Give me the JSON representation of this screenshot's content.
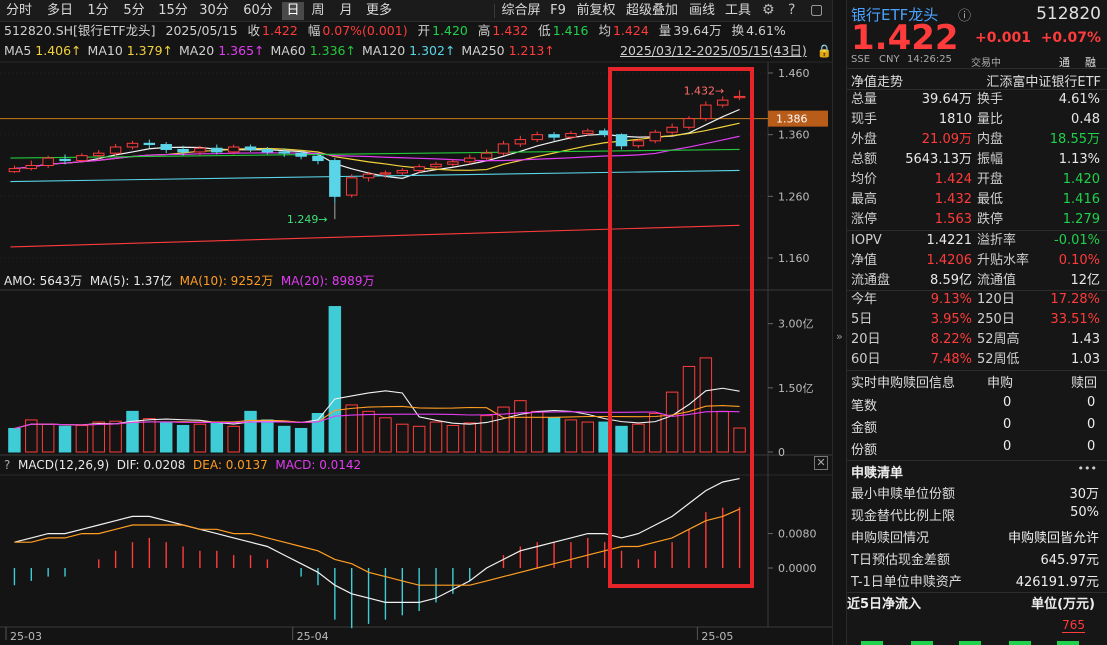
{
  "toolbar": {
    "tabs": [
      "分时",
      "多日",
      "1分",
      "5分",
      "15分",
      "30分",
      "60分",
      "日",
      "周",
      "月",
      "更多"
    ],
    "active_tab": "日",
    "right": [
      "综合屏",
      "F9",
      "前复权",
      "超级叠加",
      "画线",
      "工具"
    ]
  },
  "quote_line": {
    "code_name": "512820.SH[银行ETF龙头]",
    "date": "2025/05/15",
    "close_label": "收",
    "close": "1.422",
    "change_label": "幅",
    "change": "0.07%(0.001)",
    "open_label": "开",
    "open": "1.420",
    "high_label": "高",
    "high": "1.432",
    "low_label": "低",
    "low": "1.416",
    "avg_label": "均",
    "avg": "1.424",
    "vol_label": "量",
    "vol": "39.64万",
    "turn_label": "换",
    "turn": "4.61%"
  },
  "ma_line": {
    "items": [
      {
        "label": "MA5",
        "value": "1.406↑",
        "color": "#f2d13a"
      },
      {
        "label": "MA10",
        "value": "1.379↑",
        "color": "#f2d13a"
      },
      {
        "label": "MA20",
        "value": "1.365↑",
        "color": "#e23cf2"
      },
      {
        "label": "MA60",
        "value": "1.336↑",
        "color": "#24c93a"
      },
      {
        "label": "MA120",
        "value": "1.302↑",
        "color": "#5ad5e8"
      },
      {
        "label": "MA250",
        "value": "1.213↑",
        "color": "#ff3b3b"
      }
    ],
    "range": "2025/03/12-2025/05/15(43日)"
  },
  "price_axis": {
    "ticks": [
      "1.460",
      "1.360",
      "1.260",
      "1.160"
    ],
    "current": "1.386",
    "high_marker": "1.432",
    "low_marker": "1.249"
  },
  "amo_line": {
    "amo": "AMO: 5643万",
    "ma5": "MA(5): 1.37亿",
    "ma10": "MA(10): 9252万",
    "ma20": "MA(20): 8989万"
  },
  "amo_axis": {
    "ticks": [
      "3.00亿",
      "1.50亿",
      "0"
    ]
  },
  "macd_line": {
    "title": "MACD(12,26,9)",
    "dif": "DIF: 0.0208",
    "dea": "DEA: 0.0137",
    "macd": "MACD: 0.0142"
  },
  "macd_axis": {
    "ticks": [
      "0.0080",
      "0.0000"
    ]
  },
  "date_axis": {
    "labels": [
      "25-03",
      "25-04",
      "25-05"
    ]
  },
  "chart_data": {
    "type": "candlestick",
    "series": [
      {
        "open": 1.3,
        "close": 1.305,
        "high": 1.31,
        "low": 1.298
      },
      {
        "open": 1.305,
        "close": 1.31,
        "high": 1.318,
        "low": 1.302
      },
      {
        "open": 1.31,
        "close": 1.322,
        "high": 1.326,
        "low": 1.306
      },
      {
        "open": 1.32,
        "close": 1.318,
        "high": 1.328,
        "low": 1.312
      },
      {
        "open": 1.318,
        "close": 1.326,
        "high": 1.33,
        "low": 1.316
      },
      {
        "open": 1.326,
        "close": 1.33,
        "high": 1.335,
        "low": 1.32
      },
      {
        "open": 1.33,
        "close": 1.34,
        "high": 1.345,
        "low": 1.326
      },
      {
        "open": 1.34,
        "close": 1.346,
        "high": 1.35,
        "low": 1.336
      },
      {
        "open": 1.346,
        "close": 1.344,
        "high": 1.352,
        "low": 1.338
      },
      {
        "open": 1.344,
        "close": 1.336,
        "high": 1.348,
        "low": 1.33
      },
      {
        "open": 1.336,
        "close": 1.332,
        "high": 1.342,
        "low": 1.326
      },
      {
        "open": 1.332,
        "close": 1.338,
        "high": 1.342,
        "low": 1.326
      },
      {
        "open": 1.338,
        "close": 1.332,
        "high": 1.344,
        "low": 1.328
      },
      {
        "open": 1.332,
        "close": 1.34,
        "high": 1.344,
        "low": 1.328
      },
      {
        "open": 1.34,
        "close": 1.336,
        "high": 1.344,
        "low": 1.332
      },
      {
        "open": 1.336,
        "close": 1.332,
        "high": 1.34,
        "low": 1.328
      },
      {
        "open": 1.332,
        "close": 1.33,
        "high": 1.338,
        "low": 1.324
      },
      {
        "open": 1.33,
        "close": 1.325,
        "high": 1.334,
        "low": 1.32
      },
      {
        "open": 1.325,
        "close": 1.318,
        "high": 1.33,
        "low": 1.312
      },
      {
        "open": 1.318,
        "close": 1.26,
        "high": 1.322,
        "low": 1.249
      },
      {
        "open": 1.262,
        "close": 1.29,
        "high": 1.296,
        "low": 1.258
      },
      {
        "open": 1.29,
        "close": 1.296,
        "high": 1.3,
        "low": 1.284
      },
      {
        "open": 1.296,
        "close": 1.298,
        "high": 1.302,
        "low": 1.29
      },
      {
        "open": 1.298,
        "close": 1.302,
        "high": 1.306,
        "low": 1.294
      },
      {
        "open": 1.302,
        "close": 1.308,
        "high": 1.312,
        "low": 1.298
      },
      {
        "open": 1.308,
        "close": 1.312,
        "high": 1.316,
        "low": 1.304
      },
      {
        "open": 1.312,
        "close": 1.316,
        "high": 1.32,
        "low": 1.308
      },
      {
        "open": 1.316,
        "close": 1.322,
        "high": 1.328,
        "low": 1.312
      },
      {
        "open": 1.322,
        "close": 1.33,
        "high": 1.336,
        "low": 1.318
      },
      {
        "open": 1.33,
        "close": 1.345,
        "high": 1.35,
        "low": 1.326
      },
      {
        "open": 1.345,
        "close": 1.352,
        "high": 1.358,
        "low": 1.34
      },
      {
        "open": 1.352,
        "close": 1.36,
        "high": 1.365,
        "low": 1.348
      },
      {
        "open": 1.36,
        "close": 1.356,
        "high": 1.364,
        "low": 1.35
      },
      {
        "open": 1.356,
        "close": 1.362,
        "high": 1.366,
        "low": 1.352
      },
      {
        "open": 1.362,
        "close": 1.366,
        "high": 1.37,
        "low": 1.358
      },
      {
        "open": 1.366,
        "close": 1.36,
        "high": 1.37,
        "low": 1.356
      },
      {
        "open": 1.36,
        "close": 1.342,
        "high": 1.362,
        "low": 1.336
      },
      {
        "open": 1.342,
        "close": 1.35,
        "high": 1.354,
        "low": 1.338
      },
      {
        "open": 1.35,
        "close": 1.364,
        "high": 1.368,
        "low": 1.346
      },
      {
        "open": 1.364,
        "close": 1.372,
        "high": 1.378,
        "low": 1.36
      },
      {
        "open": 1.372,
        "close": 1.386,
        "high": 1.39,
        "low": 1.368
      },
      {
        "open": 1.386,
        "close": 1.408,
        "high": 1.414,
        "low": 1.382
      },
      {
        "open": 1.408,
        "close": 1.416,
        "high": 1.422,
        "low": 1.404
      },
      {
        "open": 1.42,
        "close": 1.422,
        "high": 1.432,
        "low": 1.416
      }
    ],
    "amo": [
      0.55,
      0.75,
      0.65,
      0.6,
      0.62,
      0.7,
      0.72,
      0.95,
      0.78,
      0.7,
      0.62,
      0.65,
      0.7,
      0.6,
      0.95,
      0.75,
      0.6,
      0.55,
      0.9,
      3.4,
      1.1,
      0.95,
      0.8,
      0.65,
      0.6,
      0.7,
      0.62,
      0.68,
      0.85,
      1.05,
      1.2,
      0.95,
      0.8,
      0.75,
      0.7,
      0.7,
      0.6,
      0.65,
      0.9,
      1.4,
      2.0,
      2.2,
      0.95,
      0.56
    ],
    "amo_dir": [
      -1,
      1,
      1,
      -1,
      1,
      1,
      1,
      -1,
      1,
      -1,
      -1,
      1,
      -1,
      1,
      -1,
      -1,
      -1,
      -1,
      -1,
      -1,
      1,
      1,
      1,
      1,
      1,
      1,
      1,
      1,
      1,
      1,
      1,
      1,
      -1,
      1,
      1,
      -1,
      -1,
      1,
      1,
      1,
      1,
      1,
      1,
      1
    ],
    "macd": [
      -0.004,
      -0.003,
      -0.002,
      -0.002,
      0.0,
      0.002,
      0.004,
      0.006,
      0.007,
      0.006,
      0.005,
      0.004,
      0.004,
      0.003,
      0.003,
      0.002,
      0.0,
      -0.002,
      -0.004,
      -0.012,
      -0.014,
      -0.013,
      -0.012,
      -0.011,
      -0.01,
      -0.008,
      -0.006,
      -0.003,
      0.0,
      0.003,
      0.005,
      0.006,
      0.006,
      0.006,
      0.007,
      0.006,
      0.004,
      0.002,
      0.004,
      0.006,
      0.009,
      0.013,
      0.014,
      0.0142
    ],
    "dif": [
      0.006,
      0.007,
      0.008,
      0.008,
      0.009,
      0.01,
      0.011,
      0.012,
      0.012,
      0.011,
      0.01,
      0.009,
      0.008,
      0.007,
      0.006,
      0.005,
      0.003,
      0.001,
      -0.001,
      -0.004,
      -0.006,
      -0.007,
      -0.008,
      -0.008,
      -0.008,
      -0.007,
      -0.005,
      -0.003,
      0.0,
      0.002,
      0.004,
      0.005,
      0.006,
      0.007,
      0.008,
      0.008,
      0.007,
      0.008,
      0.01,
      0.012,
      0.015,
      0.018,
      0.02,
      0.0208
    ],
    "dea": [
      0.006,
      0.006,
      0.007,
      0.007,
      0.008,
      0.008,
      0.009,
      0.01,
      0.01,
      0.01,
      0.01,
      0.009,
      0.009,
      0.008,
      0.008,
      0.007,
      0.006,
      0.005,
      0.004,
      0.002,
      0.001,
      -0.001,
      -0.002,
      -0.003,
      -0.004,
      -0.004,
      -0.004,
      -0.004,
      -0.003,
      -0.002,
      -0.001,
      0.0,
      0.001,
      0.002,
      0.003,
      0.004,
      0.005,
      0.005,
      0.006,
      0.007,
      0.009,
      0.011,
      0.012,
      0.0137
    ]
  },
  "right_panel": {
    "title": "银行ETF龙头",
    "code": "512820",
    "price": "1.422",
    "change": "+0.001",
    "change_pct": "+0.07%",
    "sub": [
      "SSE",
      "CNY",
      "14:26:25",
      "交易中"
    ],
    "sub_right": [
      "通",
      "融"
    ],
    "nav_label": "净值走势",
    "fund_name": "汇添富中证银行ETF",
    "rows1": [
      {
        "l1": "总量",
        "v1": "39.64万",
        "c1": "white",
        "l2": "换手",
        "v2": "4.61%",
        "c2": "white"
      },
      {
        "l1": "现手",
        "v1": "1810",
        "c1": "white",
        "l2": "量比",
        "v2": "0.48",
        "c2": "white"
      },
      {
        "l1": "外盘",
        "v1": "21.09万",
        "c1": "red",
        "l2": "内盘",
        "v2": "18.55万",
        "c2": "green"
      },
      {
        "l1": "总额",
        "v1": "5643.13万",
        "c1": "white",
        "l2": "振幅",
        "v2": "1.13%",
        "c2": "white"
      },
      {
        "l1": "均价",
        "v1": "1.424",
        "c1": "red",
        "l2": "开盘",
        "v2": "1.420",
        "c2": "green"
      },
      {
        "l1": "最高",
        "v1": "1.432",
        "c1": "red",
        "l2": "最低",
        "v2": "1.416",
        "c2": "green"
      },
      {
        "l1": "涨停",
        "v1": "1.563",
        "c1": "red",
        "l2": "跌停",
        "v2": "1.279",
        "c2": "green"
      }
    ],
    "rows2": [
      {
        "l1": "IOPV",
        "v1": "1.4221",
        "c1": "white",
        "l2": "溢折率",
        "v2": "-0.01%",
        "c2": "green"
      },
      {
        "l1": "净值",
        "v1": "1.4206",
        "c1": "red",
        "l2": "升贴水率",
        "v2": "0.10%",
        "c2": "red"
      },
      {
        "l1": "流通盘",
        "v1": "8.59亿",
        "c1": "white",
        "l2": "流通值",
        "v2": "12亿",
        "c2": "white"
      }
    ],
    "rows3": [
      {
        "l1": "今年",
        "v1": "9.13%",
        "c1": "red",
        "l2": "120日",
        "v2": "17.28%",
        "c2": "red"
      },
      {
        "l1": "5日",
        "v1": "3.95%",
        "c1": "red",
        "l2": "250日",
        "v2": "33.51%",
        "c2": "red"
      },
      {
        "l1": "20日",
        "v1": "8.22%",
        "c1": "red",
        "l2": "52周高",
        "v2": "1.43",
        "c2": "white"
      },
      {
        "l1": "60日",
        "v1": "7.48%",
        "c1": "red",
        "l2": "52周低",
        "v2": "1.03",
        "c2": "white"
      }
    ],
    "realtime": {
      "title": "实时申购赎回信息",
      "col1": "申购",
      "col2": "赎回",
      "rows": [
        {
          "l": "笔数",
          "a": "0",
          "b": "0"
        },
        {
          "l": "金额",
          "a": "0",
          "b": "0"
        },
        {
          "l": "份额",
          "a": "0",
          "b": "0"
        }
      ]
    },
    "list": {
      "title": "申赎清单",
      "more": "•••",
      "rows": [
        {
          "l": "最小申赎单位份额",
          "v": "30万"
        },
        {
          "l": "现金替代比例上限",
          "v": "50%"
        },
        {
          "l": "申购赎回情况",
          "v": "申购赎回皆允许"
        },
        {
          "l": "T日预估现金差额",
          "v": "645.97元"
        },
        {
          "l": "T-1日单位申赎资产",
          "v": "426191.97元"
        }
      ]
    },
    "inflow": {
      "title": "近5日净流入",
      "unit": "单位(万元)",
      "value": "765"
    }
  }
}
